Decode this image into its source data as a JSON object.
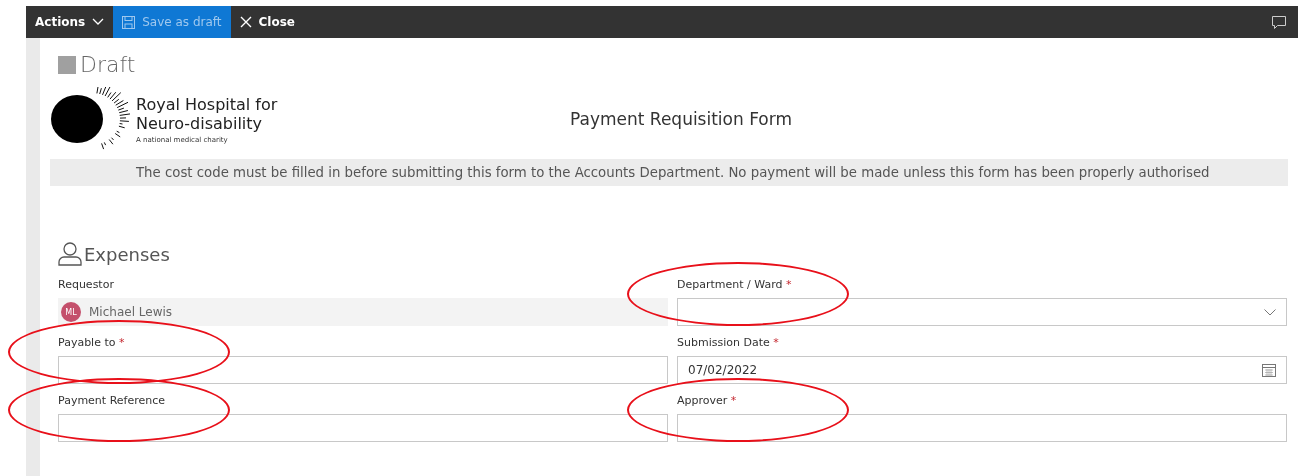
{
  "toolbar": {
    "items": [
      {
        "label": "Actions",
        "kind": "menu",
        "selected": false
      },
      {
        "label": "Save as draft",
        "kind": "save",
        "selected": true
      },
      {
        "label": "Close",
        "kind": "close",
        "selected": false
      }
    ]
  },
  "status": "Draft",
  "logo": {
    "line_1": "Royal Hospital for",
    "line_2": "Neuro-disability",
    "tagline": "A national medical charity"
  },
  "form_title": "Payment Requisition Form",
  "notice": "The cost code must be filled in before submitting this form to the Accounts Department. No payment will be made unless this form has been properly authorised",
  "section": {
    "title": "Expenses"
  },
  "fields": [
    {
      "label": "Requestor",
      "kind": "person",
      "circled": false,
      "initials": "ML",
      "value": "Michael Lewis"
    },
    {
      "label": "Department / Ward",
      "kind": "dropdown",
      "required_mark": "*",
      "circled": true
    },
    {
      "label": "Payable to",
      "kind": "text",
      "required_mark": "*",
      "circled": true
    },
    {
      "label": "Submission Date",
      "kind": "date",
      "required_mark": "*",
      "circled": false,
      "value": "07/02/2022"
    },
    {
      "label": "Payment Reference",
      "kind": "text",
      "circled": true
    },
    {
      "label": "Approver",
      "kind": "text",
      "required_mark": "*",
      "circled": true
    }
  ]
}
